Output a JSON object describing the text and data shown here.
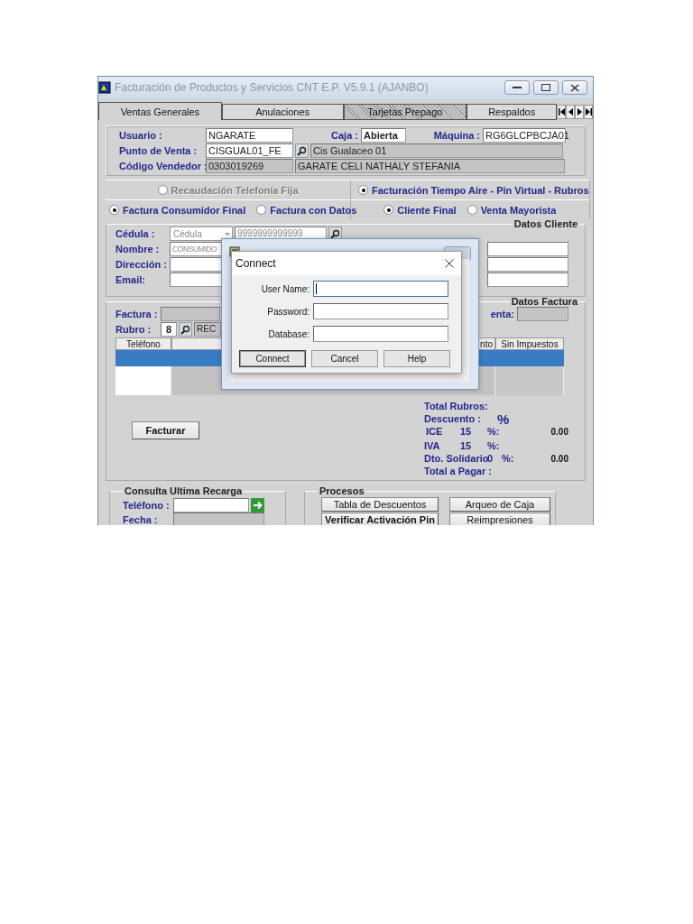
{
  "window": {
    "title": "Facturación de Productos y Servicios CNT E.P.  V5.9.1 (AJANBO)"
  },
  "tabs": [
    {
      "label": "Ventas Generales",
      "selected": true,
      "hatched": false
    },
    {
      "label": "Anulaciones",
      "selected": false,
      "hatched": false
    },
    {
      "label": "Tarjetas Prepago",
      "selected": false,
      "hatched": true
    },
    {
      "label": "Respaldos",
      "selected": false,
      "hatched": false
    }
  ],
  "header": {
    "usuario": {
      "label": "Usuario :",
      "value": "NGARATE"
    },
    "caja": {
      "label": "Caja :",
      "value": "Abierta"
    },
    "maquina": {
      "label": "Máquina :",
      "value": "RG6GLCPBCJA01"
    },
    "punto_venta": {
      "label": "Punto de Venta :",
      "value": "CISGUAL01_FE",
      "description": "Cis Gualaceo 01"
    },
    "codigo_vendedor": {
      "label": "Código Vendedor :",
      "value": "0303019269",
      "name": "GARATE CELI NATHALY STEFANIA"
    }
  },
  "service_options": [
    {
      "label": "Recaudación Telefonía Fija",
      "selected": false,
      "disabled": true
    },
    {
      "label": "Facturación Tiempo Aire - Pin Virtual - Rubros",
      "selected": true,
      "disabled": false
    }
  ],
  "invoice_type": [
    {
      "label": "Factura Consumidor Final",
      "selected": true
    },
    {
      "label": "Factura con Datos",
      "selected": false
    }
  ],
  "client_type": [
    {
      "label": "Cliente Final",
      "selected": true
    },
    {
      "label": "Venta Mayorista",
      "selected": false
    }
  ],
  "datos_cliente": {
    "title": "Datos Cliente",
    "cedula": {
      "label": "Cédula :",
      "type": "Cédula",
      "value": "9999999999999"
    },
    "nombre": {
      "label": "Nombre :",
      "value": "CONSUMIDO"
    },
    "direccion": {
      "label": "Dirección :"
    },
    "email": {
      "label": "Email:"
    }
  },
  "datos_factura": {
    "title": "Datos Factura",
    "factura_label": "Factura :",
    "rubro": {
      "label": "Rubro :",
      "value": "8",
      "description": "REC"
    },
    "venta_label": "enta:",
    "table": {
      "columns": [
        {
          "label": "Teléfono"
        },
        {
          "label": "nto"
        },
        {
          "label": "Sin Impuestos"
        }
      ]
    }
  },
  "totals": {
    "total_rubros": "Total  Rubros:",
    "descuento": {
      "label": "Descuento :",
      "unit": "%"
    },
    "ice": {
      "label": "ICE",
      "rate": "15",
      "unit": "%:",
      "value": "0.00"
    },
    "iva": {
      "label": "IVA",
      "rate": "15",
      "unit": "%:"
    },
    "solidario": {
      "label": "Dto. Solidario",
      "rate": "0",
      "unit": "%:",
      "value": "0.00"
    },
    "total_pagar": "Total a Pagar :"
  },
  "facturar_button": "Facturar",
  "consulta": {
    "title": "Consulta Ultima Recarga",
    "telefono_label": "Teléfono :",
    "fecha_label": "Fecha :"
  },
  "procesos": {
    "title": "Procesos",
    "buttons": [
      {
        "label": "Tabla de Descuentos",
        "focused": false
      },
      {
        "label": "Arqueo de Caja",
        "focused": false
      },
      {
        "label": "Verificar Activación Pin",
        "focused": true
      },
      {
        "label": "Reimpresiones",
        "focused": false
      }
    ]
  },
  "connect_dialog": {
    "title": "Connect",
    "fields": [
      {
        "label": "User Name:",
        "focused": true
      },
      {
        "label": "Password:",
        "focused": false
      },
      {
        "label": "Database:",
        "focused": false
      }
    ],
    "buttons": [
      {
        "label": "Connect",
        "default": true
      },
      {
        "label": "Cancel",
        "default": false
      },
      {
        "label": "Help",
        "default": false
      }
    ]
  }
}
